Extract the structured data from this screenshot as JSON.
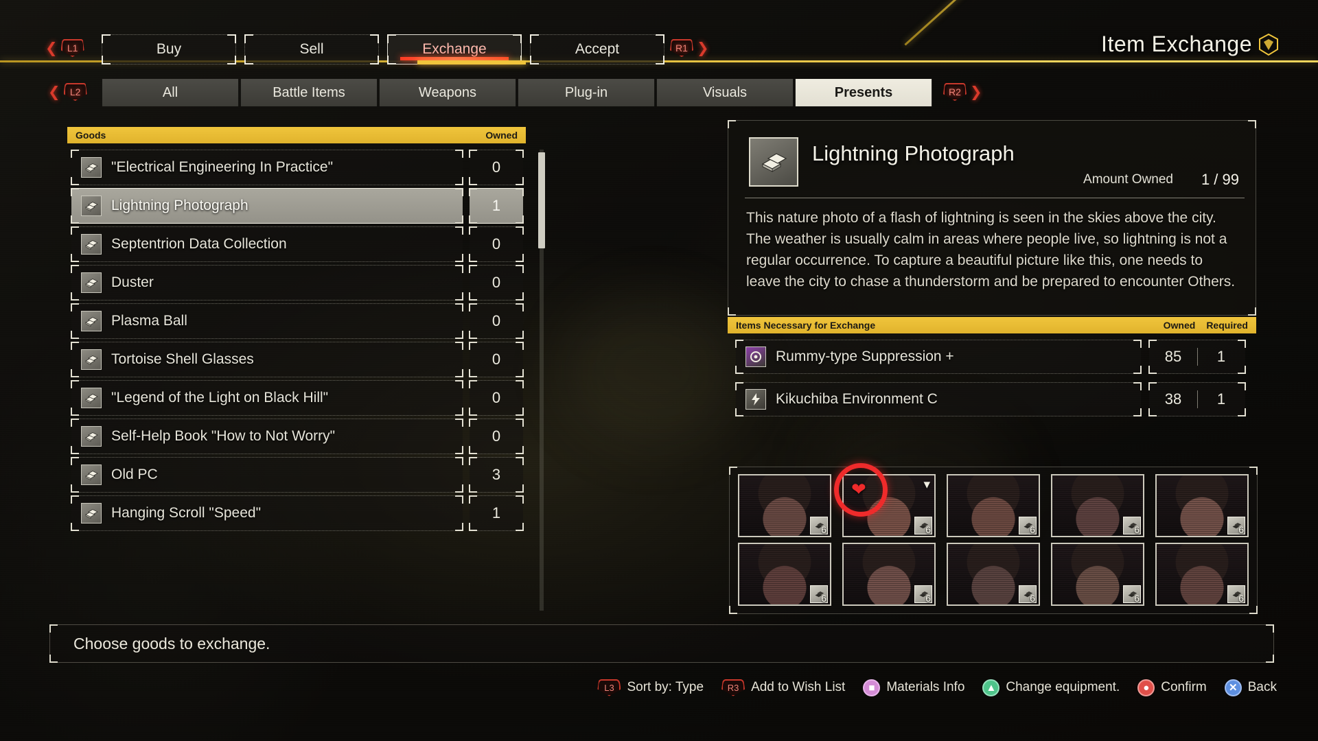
{
  "header": {
    "title": "Item Exchange",
    "icon": "exchange-diamond-icon"
  },
  "nav": {
    "left_bumper": "L1",
    "right_bumper": "R1",
    "left_category_bumper": "L2",
    "right_category_bumper": "R2",
    "tabs": [
      {
        "label": "Buy",
        "selected": false
      },
      {
        "label": "Sell",
        "selected": false
      },
      {
        "label": "Exchange",
        "selected": true
      },
      {
        "label": "Accept",
        "selected": false
      }
    ],
    "categories": [
      {
        "label": "All",
        "selected": false
      },
      {
        "label": "Battle Items",
        "selected": false
      },
      {
        "label": "Weapons",
        "selected": false
      },
      {
        "label": "Plug-in",
        "selected": false
      },
      {
        "label": "Visuals",
        "selected": false
      },
      {
        "label": "Presents",
        "selected": true
      }
    ]
  },
  "goods": {
    "header_label": "Goods",
    "owned_label": "Owned",
    "items": [
      {
        "name": "\"Electrical Engineering In Practice\"",
        "owned": "0",
        "selected": false
      },
      {
        "name": "Lightning Photograph",
        "owned": "1",
        "selected": true
      },
      {
        "name": "Septentrion Data Collection",
        "owned": "0",
        "selected": false
      },
      {
        "name": "Duster",
        "owned": "0",
        "selected": false
      },
      {
        "name": "Plasma Ball",
        "owned": "0",
        "selected": false
      },
      {
        "name": "Tortoise Shell Glasses",
        "owned": "0",
        "selected": false
      },
      {
        "name": "\"Legend of the Light on Black Hill\"",
        "owned": "0",
        "selected": false
      },
      {
        "name": "Self-Help Book \"How to Not Worry\"",
        "owned": "0",
        "selected": false
      },
      {
        "name": "Old PC",
        "owned": "3",
        "selected": false
      },
      {
        "name": "Hanging Scroll \"Speed\"",
        "owned": "1",
        "selected": false
      }
    ]
  },
  "detail": {
    "title": "Lightning Photograph",
    "icon": "item-stack-icon",
    "amount_owned_label": "Amount Owned",
    "amount_owned_value": "1 / 99",
    "description": "This nature photo of a flash of lightning is seen in the skies above the city. The weather is usually calm in areas where people live, so lightning is not a regular occurrence. To capture a beautiful picture like this, one needs to leave the city to chase a thunderstorm and be prepared to encounter Others."
  },
  "materials": {
    "header_label": "Items Necessary for Exchange",
    "owned_label": "Owned",
    "required_label": "Required",
    "rows": [
      {
        "name": "Rummy-type Suppression +",
        "owned": "85",
        "required": "1",
        "icon": "plugin-chip-icon",
        "icon_color": "#8c3fa8"
      },
      {
        "name": "Kikuchiba Environment C",
        "owned": "38",
        "required": "1",
        "icon": "bolt-icon",
        "icon_color": "#6e6c63"
      }
    ]
  },
  "recipients": {
    "badge_number": "6",
    "cells": [
      {
        "row": 0,
        "col": 0,
        "selected": false,
        "tone": "#6a4a44"
      },
      {
        "row": 0,
        "col": 1,
        "selected": true,
        "tone": "#7a5248"
      },
      {
        "row": 0,
        "col": 2,
        "selected": false,
        "tone": "#6d4a42"
      },
      {
        "row": 0,
        "col": 3,
        "selected": false,
        "tone": "#5e4240"
      },
      {
        "row": 0,
        "col": 4,
        "selected": false,
        "tone": "#74524a"
      },
      {
        "row": 1,
        "col": 0,
        "selected": false,
        "tone": "#5f3f3c"
      },
      {
        "row": 1,
        "col": 1,
        "selected": false,
        "tone": "#71504a"
      },
      {
        "row": 1,
        "col": 2,
        "selected": false,
        "tone": "#5a4340"
      },
      {
        "row": 1,
        "col": 3,
        "selected": false,
        "tone": "#6a4f46"
      },
      {
        "row": 1,
        "col": 4,
        "selected": false,
        "tone": "#62443f"
      }
    ],
    "highlight_icon": "heart-icon",
    "chevron_icon": "chevron-down-icon"
  },
  "status": {
    "message": "Choose goods to exchange."
  },
  "footer_hints": [
    {
      "key": "L3",
      "key_type": "stick",
      "label": "Sort by: Type"
    },
    {
      "key": "R3",
      "key_type": "stick",
      "label": "Add to Wish List"
    },
    {
      "key": "■",
      "key_type": "square",
      "label": "Materials Info"
    },
    {
      "key": "▲",
      "key_type": "triangle",
      "label": "Change equipment."
    },
    {
      "key": "●",
      "key_type": "circle",
      "label": "Confirm"
    },
    {
      "key": "✕",
      "key_type": "cross",
      "label": "Back"
    }
  ],
  "colors": {
    "accent_gold": "#f0c53c",
    "accent_red": "#ff3b22",
    "highlight_circle": "#ef2b2b",
    "panel_bg": "#12110e",
    "text": "#e8e6dd"
  }
}
